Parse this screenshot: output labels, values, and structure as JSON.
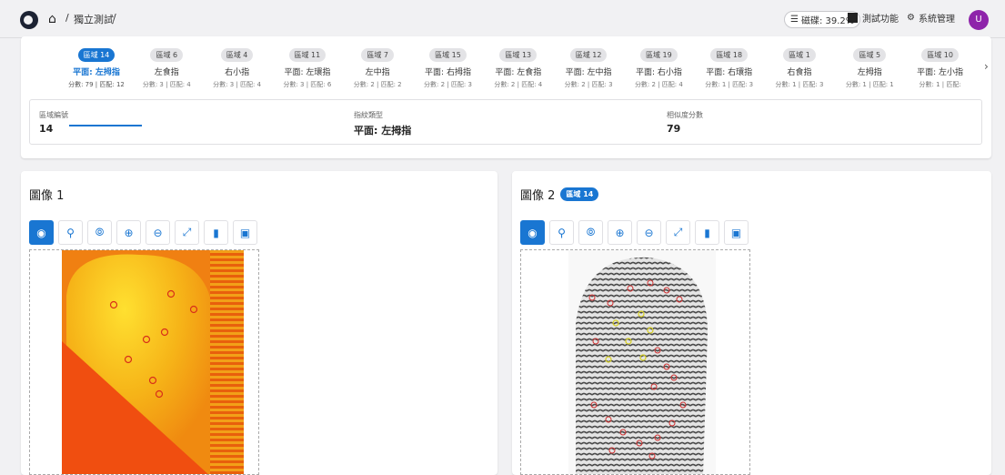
{
  "breadcrumb": {
    "separator1": "/",
    "page": "獨立測試",
    "separator2": "/"
  },
  "topbar": {
    "disk_label": "磁碟: 39.2%",
    "test_label": "測試功能",
    "admin_label": "系統管理",
    "avatar_letter": "U"
  },
  "tabs": [
    {
      "badge": "區域 14",
      "name": "平面: 左拇指",
      "meta": "分數: 79 | 匹配: 12",
      "active": true
    },
    {
      "badge": "區域 6",
      "name": "左食指",
      "meta": "分數: 3 | 匹配: 4"
    },
    {
      "badge": "區域 4",
      "name": "右小指",
      "meta": "分數: 3 | 匹配: 4"
    },
    {
      "badge": "區域 11",
      "name": "平面: 左環指",
      "meta": "分數: 3 | 匹配: 6"
    },
    {
      "badge": "區域 7",
      "name": "左中指",
      "meta": "分數: 2 | 匹配: 2"
    },
    {
      "badge": "區域 15",
      "name": "平面: 右拇指",
      "meta": "分數: 2 | 匹配: 3"
    },
    {
      "badge": "區域 13",
      "name": "平面: 左食指",
      "meta": "分數: 2 | 匹配: 4"
    },
    {
      "badge": "區域 12",
      "name": "平面: 左中指",
      "meta": "分數: 2 | 匹配: 3"
    },
    {
      "badge": "區域 19",
      "name": "平面: 右小指",
      "meta": "分數: 2 | 匹配: 4"
    },
    {
      "badge": "區域 18",
      "name": "平面: 右環指",
      "meta": "分數: 1 | 匹配: 3"
    },
    {
      "badge": "區域 1",
      "name": "右食指",
      "meta": "分數: 1 | 匹配: 3"
    },
    {
      "badge": "區域 5",
      "name": "左拇指",
      "meta": "分數: 1 | 匹配: 1"
    },
    {
      "badge": "區域 10",
      "name": "平面: 左小指",
      "meta": "分數: 1 | 匹配:"
    }
  ],
  "info": {
    "region_label": "區域編號",
    "region_value": "14",
    "type_label": "指紋類型",
    "type_value": "平面: 左拇指",
    "score_label": "相似度分數",
    "score_value": "79"
  },
  "image1": {
    "title": "圖像 1"
  },
  "image2": {
    "title": "圖像 2",
    "chip": "區域 14"
  },
  "colors": {
    "accent": "#1976d2",
    "avatar": "#8e24aa"
  }
}
